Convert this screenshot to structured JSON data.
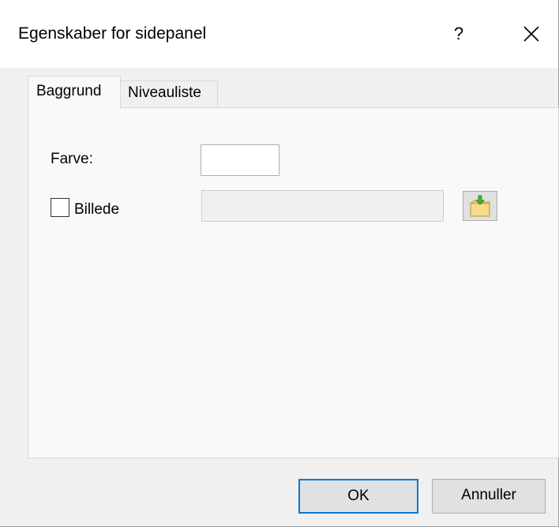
{
  "dialog": {
    "title": "Egenskaber for sidepanel",
    "help_label": "?",
    "close_icon": "close-icon"
  },
  "tabs": [
    {
      "label": "Baggrund",
      "active": true
    },
    {
      "label": "Niveauliste",
      "active": false
    }
  ],
  "background_tab": {
    "color_label": "Farve:",
    "color_value": "#ffffff",
    "image_checkbox_label": "Billede",
    "image_checked": false,
    "image_path": "",
    "browse_icon": "folder-import-icon"
  },
  "footer": {
    "ok_label": "OK",
    "cancel_label": "Annuller"
  },
  "colors": {
    "dialog_bg": "#f0f0f0",
    "panel_bg": "#f9f9f9",
    "default_button_border": "#0078d7"
  }
}
